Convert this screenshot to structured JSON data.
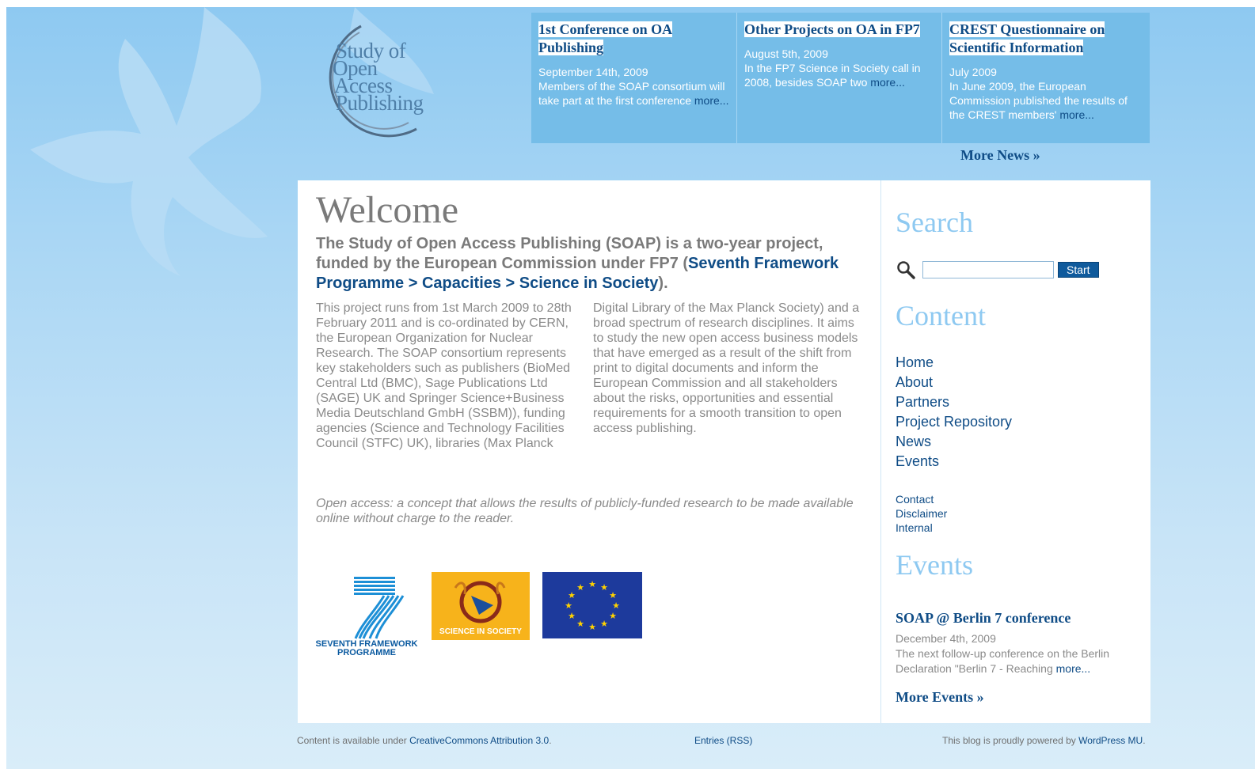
{
  "logo": {
    "lines": [
      "Study of",
      "Open",
      "Access",
      "Publishing"
    ]
  },
  "news": [
    {
      "title": "1st Conference on OA Publishing",
      "date": "September 14th, 2009",
      "excerpt": "Members of the SOAP consortium will take part at the first conference",
      "more": "more..."
    },
    {
      "title": "Other Projects on OA in FP7",
      "date": "August 5th, 2009",
      "excerpt": "In the FP7 Science in Society call in 2008, besides SOAP two",
      "more": "more..."
    },
    {
      "title": "CREST Questionnaire on Scientific Information",
      "date": "July 2009",
      "excerpt": "In June 2009, the European Commission published the results of the CREST members'",
      "more": "more..."
    }
  ],
  "more_news": "More News »",
  "main": {
    "title": "Welcome",
    "intro_text": "The Study of Open Access Publishing (SOAP) is a two-year project, funded by the European Commission under FP7 (",
    "intro_link": "Seventh Framework Programme > Capacities > Science in Society",
    "intro_end": ").",
    "col1": "This project runs from 1st March 2009 to 28th February 2011 and is co-ordinated by CERN, the European Organization for Nuclear Research. The SOAP consortium represents key stakeholders such as publishers (BioMed Central Ltd (BMC), Sage Publications Ltd (SAGE) UK and Springer Science+Business Media Deutschland GmbH (SSBM)), funding agencies (Science and Technology Facilities Council (STFC) UK), libraries (Max Planck",
    "col2": "Digital Library of the Max Planck Society) and a broad spectrum of research disciplines. It aims to study the new open access business models that have emerged as a result of the shift from print to digital documents and inform the European Commission and all stakeholders about the risks, opportunities and essential requirements for a smooth transition to open access publishing.",
    "quote": "Open access: a concept that allows the results of publicly-funded research to be made available online without charge to the reader.",
    "logos": {
      "fp7_line1": "SEVENTH FRAMEWORK",
      "fp7_line2": "PROGRAMME",
      "sis": "SCIENCE IN SOCIETY"
    }
  },
  "sidebar": {
    "search_heading": "Search",
    "search_value": "",
    "search_button": "Start",
    "content_heading": "Content",
    "content_links": [
      "Home",
      "About",
      "Partners",
      "Project Repository",
      "News",
      "Events"
    ],
    "small_links": [
      "Contact",
      "Disclaimer",
      "Internal"
    ],
    "events_heading": "Events",
    "event": {
      "title": "SOAP @ Berlin 7 conference",
      "date": "December 4th, 2009",
      "excerpt": "The next follow-up conference on the Berlin Declaration \"Berlin 7 - Reaching",
      "more": "more..."
    },
    "more_events": "More Events »"
  },
  "footer": {
    "left_text": "Content is available under ",
    "left_link": "CreativeCommons Attribution 3.0",
    "left_end": ".",
    "center_link": "Entries (RSS)",
    "right_text": "This blog is proudly powered by ",
    "right_link": "WordPress MU",
    "right_end": "."
  },
  "colors": {
    "brand_blue": "#0f4c86",
    "news_bg": "#75bde8",
    "heading_light_blue": "#8ec9f1"
  }
}
